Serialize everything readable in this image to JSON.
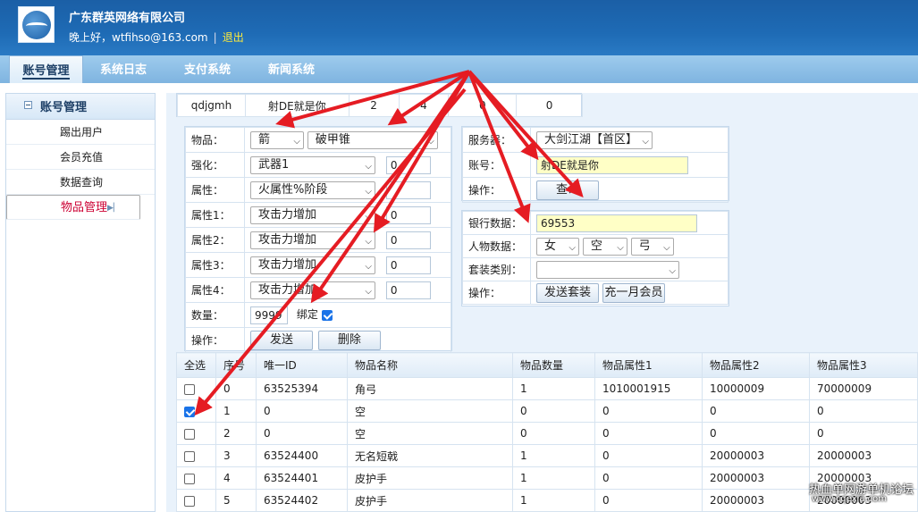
{
  "header": {
    "company": "广东群英网络有限公司",
    "greeting": "晚上好，wtfihso@163.com",
    "separator": "|",
    "logout": "退出"
  },
  "tabs": [
    {
      "label": "账号管理",
      "active": true
    },
    {
      "label": "系统日志"
    },
    {
      "label": "支付系统"
    },
    {
      "label": "新闻系统"
    }
  ],
  "sidebar": {
    "title": "账号管理",
    "items": [
      {
        "label": "踢出用户"
      },
      {
        "label": "会员充值"
      },
      {
        "label": "数据查询"
      },
      {
        "label": "物品管理",
        "selected": true
      }
    ]
  },
  "summary_row": [
    "qdjgmh",
    "射DE就是你",
    "2",
    "4",
    "0",
    "0"
  ],
  "item_form": {
    "item": {
      "label": "物品：",
      "category": "箭",
      "name": "破甲锥"
    },
    "enhance": {
      "label": "强化：",
      "value": "武器1",
      "num": "0"
    },
    "attribute": {
      "label": "属性：",
      "value": "火属性%阶段",
      "num": ""
    },
    "attr1": {
      "label": "属性1：",
      "value": "攻击力增加",
      "num": "0"
    },
    "attr2": {
      "label": "属性2：",
      "value": "攻击力增加",
      "num": "0"
    },
    "attr3": {
      "label": "属性3：",
      "value": "攻击力增加",
      "num": "0"
    },
    "attr4": {
      "label": "属性4：",
      "value": "攻击力增加",
      "num": "0"
    },
    "quantity": {
      "label": "数量：",
      "value": "9999",
      "bind_label": "绑定",
      "bound": true
    },
    "ops": {
      "label": "操作：",
      "send": "发送",
      "delete": "删除"
    }
  },
  "server_form": {
    "server": {
      "label": "服务器：",
      "value": "大剑江湖【首区】"
    },
    "account": {
      "label": "账号：",
      "value": "射DE就是你"
    },
    "ops": {
      "label": "操作：",
      "query": "查询"
    }
  },
  "bank_form": {
    "bank": {
      "label": "银行数据：",
      "value": "69553"
    },
    "character": {
      "label": "人物数据：",
      "gender": "女",
      "element": "空",
      "class": "弓"
    },
    "suit": {
      "label": "套装类别：",
      "value": ""
    },
    "ops": {
      "label": "操作：",
      "send_suit": "发送套装",
      "recharge": "充一月会员"
    }
  },
  "table": {
    "headers": [
      "全选",
      "序号",
      "唯一ID",
      "物品名称",
      "物品数量",
      "物品属性1",
      "物品属性2",
      "物品属性3"
    ],
    "rows": [
      {
        "checked": false,
        "cells": [
          "0",
          "63525394",
          "角弓",
          "1",
          "1010001915",
          "10000009",
          "70000009"
        ]
      },
      {
        "checked": true,
        "cells": [
          "1",
          "0",
          "空",
          "0",
          "0",
          "0",
          "0"
        ]
      },
      {
        "checked": false,
        "cells": [
          "2",
          "0",
          "空",
          "0",
          "0",
          "0",
          "0"
        ]
      },
      {
        "checked": false,
        "cells": [
          "3",
          "63524400",
          "无名短戟",
          "1",
          "0",
          "20000003",
          "20000003"
        ]
      },
      {
        "checked": false,
        "cells": [
          "4",
          "63524401",
          "皮护手",
          "1",
          "0",
          "20000003",
          "20000003"
        ]
      },
      {
        "checked": false,
        "cells": [
          "5",
          "63524402",
          "皮护手",
          "1",
          "0",
          "20000003",
          "20000003"
        ]
      }
    ]
  },
  "watermark": {
    "line1": "热血单网游单机论坛",
    "line2": "www.cqexia.com"
  },
  "colors": {
    "header_blue": "#1e6bb5",
    "arrow_red": "#e51c23",
    "selected_red": "#cc0033",
    "highlight_yellow": "#ffffc6"
  }
}
